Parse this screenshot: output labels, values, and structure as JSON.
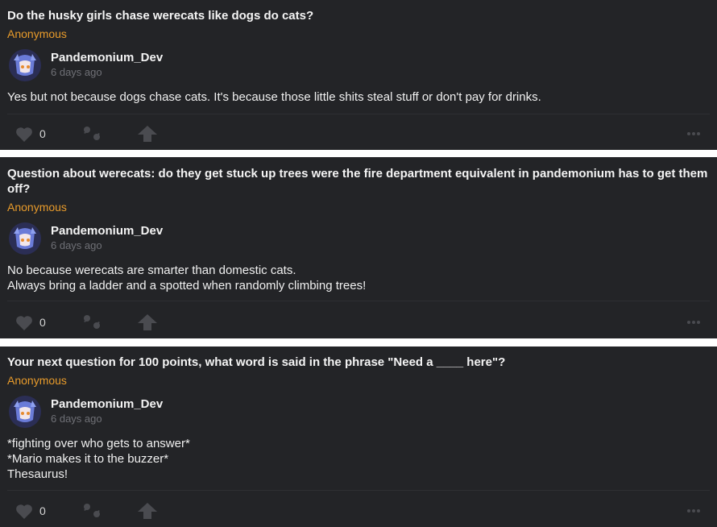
{
  "posts": [
    {
      "question": "Do the husky girls chase werecats like dogs do cats?",
      "asker": "Anonymous",
      "author": "Pandemonium_Dev",
      "time": "6 days ago",
      "answer_lines": [
        "Yes but not because dogs chase cats. It's because those little shits steal stuff or don't pay for drinks."
      ],
      "likes": "0"
    },
    {
      "question": "Question about werecats: do they get stuck up trees were the fire department equivalent in pandemonium has to get them off?",
      "asker": "Anonymous",
      "author": "Pandemonium_Dev",
      "time": "6 days ago",
      "answer_lines": [
        "No because werecats are smarter than domestic cats.",
        "Always bring a ladder and a spotted when randomly climbing trees!"
      ],
      "likes": "0"
    },
    {
      "question": "Your next question for 100 points, what word is said in the phrase \"Need a ____ here\"?",
      "asker": "Anonymous",
      "author": "Pandemonium_Dev",
      "time": "6 days ago",
      "answer_lines": [
        "*fighting over who gets to answer*",
        "*Mario makes it to the buzzer*",
        "Thesaurus!"
      ],
      "likes": "0"
    }
  ],
  "icons": {
    "like": "heart-icon",
    "share": "quote-icon",
    "upvote": "arrow-up-icon",
    "more": "more-dots-icon"
  },
  "colors": {
    "card_bg": "#232427",
    "asker": "#e89b2b",
    "time": "#6f7076",
    "icon": "#4a4b50",
    "separator": "#ffffff"
  }
}
